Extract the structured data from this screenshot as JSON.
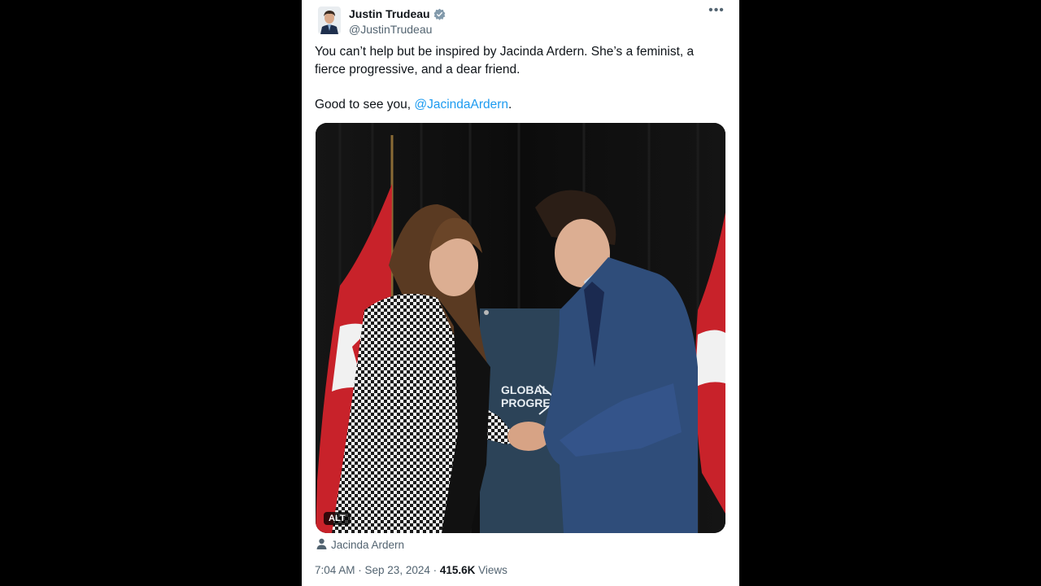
{
  "tweet": {
    "author_name": "Justin Trudeau",
    "author_handle": "@JustinTrudeau",
    "verified": true,
    "text_line1": "You can’t help but be inspired by Jacinda Ardern. She’s a feminist, a fierce progressive, and a dear friend.",
    "text_line2_prefix": "Good to see you, ",
    "mention": "@JacindaArdern",
    "text_line2_suffix": ".",
    "media": {
      "alt_badge": "ALT",
      "banner_text_1": "GLOBAL",
      "banner_text_2": "PROGRESS"
    },
    "tagged_person": "Jacinda Ardern",
    "timestamp": "7:04 AM · Sep 23, 2024",
    "separator": " · ",
    "views_count": "415.6K",
    "views_label": " Views",
    "more_glyph": "•••"
  },
  "colors": {
    "background": "#000000",
    "card": "#ffffff",
    "link": "#1d9bf0",
    "text": "#0f1419",
    "muted": "#536471",
    "verified": "#829aab"
  },
  "icons": [
    "verified-badge-icon",
    "more-icon",
    "person-icon"
  ]
}
